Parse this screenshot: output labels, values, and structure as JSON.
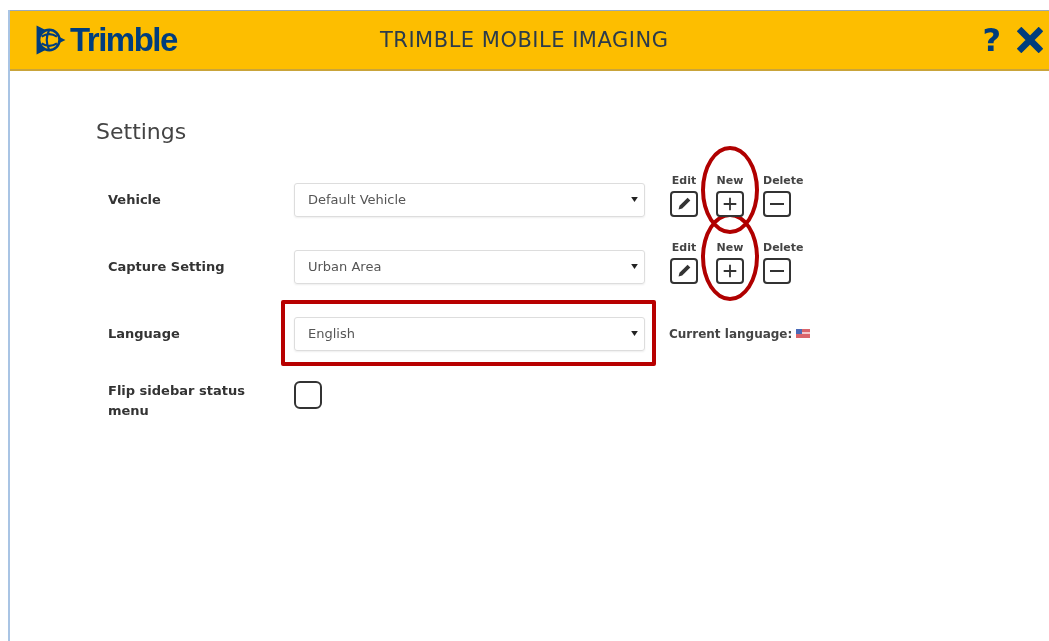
{
  "header": {
    "logo_text": "Trimble",
    "title": "TRIMBLE MOBILE IMAGING",
    "help": "?"
  },
  "page": {
    "title": "Settings"
  },
  "rows": [
    {
      "kind": "select",
      "label": "Vehicle",
      "value": "Default Vehicle",
      "actions": [
        "Edit",
        "New",
        "Delete"
      ],
      "new_circled": true
    },
    {
      "kind": "select",
      "label": "Capture Setting",
      "value": "Urban Area",
      "actions": [
        "Edit",
        "New",
        "Delete"
      ],
      "new_circled": true
    },
    {
      "kind": "select",
      "label": "Language",
      "value": "English",
      "highlighted": true,
      "note": "Current language:"
    },
    {
      "kind": "checkbox",
      "label": "Flip sidebar status menu",
      "checked": false
    }
  ]
}
